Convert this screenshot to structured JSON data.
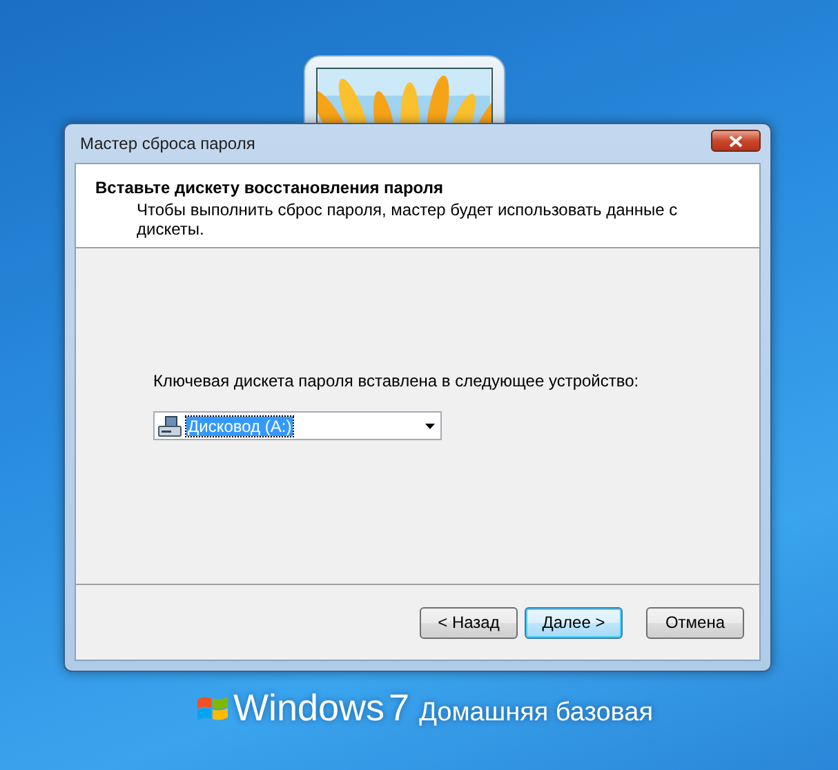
{
  "window": {
    "title": "Мастер сброса пароля"
  },
  "header": {
    "title": "Вставьте дискету восстановления пароля",
    "subtitle": "Чтобы выполнить сброс пароля, мастер будет использовать данные с дискеты."
  },
  "device_label": "Ключевая дискета пароля вставлена в следующее устройство:",
  "device_select": {
    "value": "Дисковод (A:)",
    "focused": true
  },
  "buttons": [
    {
      "label": "< Назад",
      "default": false
    },
    {
      "label": "Далее >",
      "default": true
    },
    {
      "label": "Отмена",
      "default": false
    }
  ],
  "branding": {
    "product": "Windows",
    "version": "7",
    "edition": "Домашняя базовая"
  }
}
